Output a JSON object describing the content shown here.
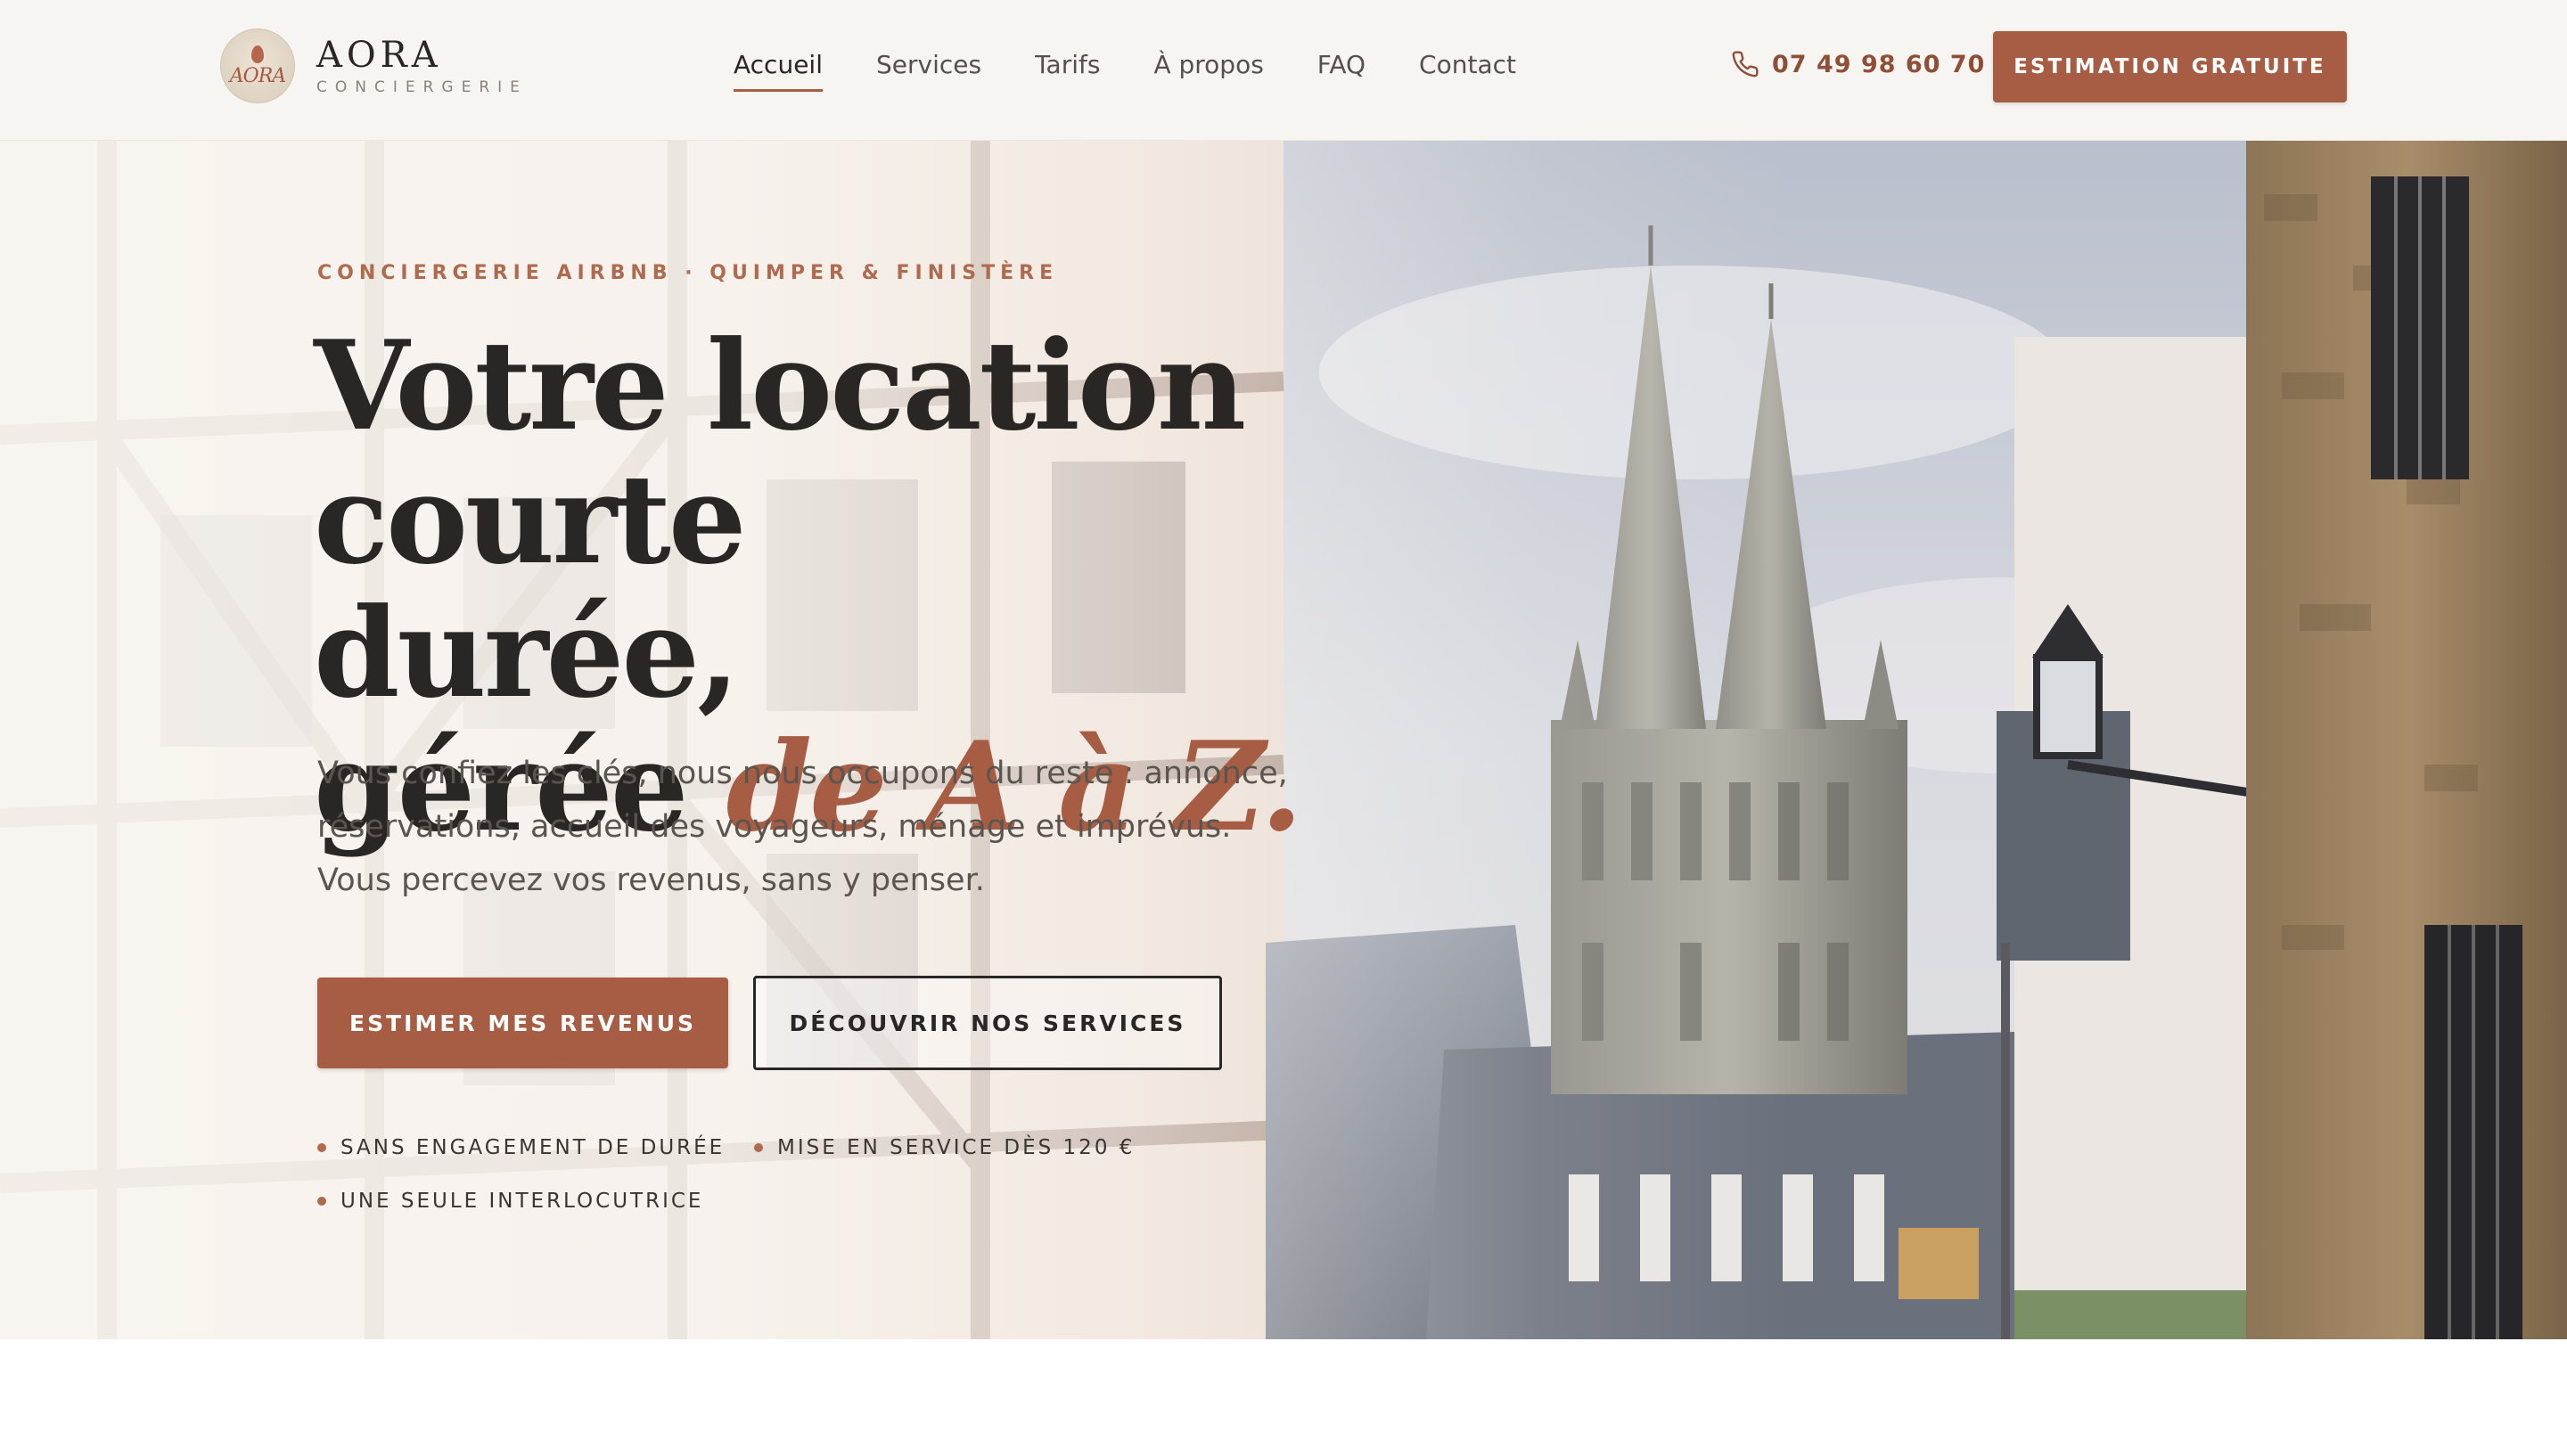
{
  "brand": {
    "name": "AORA",
    "tagline": "CONCIERGERIE",
    "monogram": "AORA"
  },
  "nav": {
    "items": [
      {
        "label": "Accueil",
        "active": true
      },
      {
        "label": "Services",
        "active": false
      },
      {
        "label": "Tarifs",
        "active": false
      },
      {
        "label": "À propos",
        "active": false
      },
      {
        "label": "FAQ",
        "active": false
      },
      {
        "label": "Contact",
        "active": false
      }
    ]
  },
  "header": {
    "phone": "07 49 98 60 70",
    "phone_icon": "phone-icon",
    "cta_label": "ESTIMATION GRATUITE"
  },
  "hero": {
    "eyebrow": "CONCIERGERIE AIRBNB · QUIMPER & FINISTÈRE",
    "headline_line1": "Votre location courte",
    "headline_line2": "durée,",
    "headline_line3_prefix": "gérée ",
    "headline_accent": "de A à Z.",
    "lead_line1": "Vous confiez les clés, nous nous occupons du reste : annonce,",
    "lead_line2": "réservations, accueil des voyageurs, ménage et imprévus.",
    "lead_line3": "Vous percevez vos revenus, sans y penser.",
    "primary_cta": "ESTIMER MES REVENUS",
    "secondary_cta": "DÉCOUVRIR NOS SERVICES",
    "perks": [
      "SANS ENGAGEMENT DE DURÉE",
      "MISE EN SERVICE DÈS 120 €",
      "UNE SEULE INTERLOCUTRICE"
    ]
  },
  "colors": {
    "accent": "#a65d43",
    "accent_dark": "#8f4f37",
    "text": "#2a2623",
    "muted": "#5b5550",
    "header_bg": "#f7f5f1"
  }
}
